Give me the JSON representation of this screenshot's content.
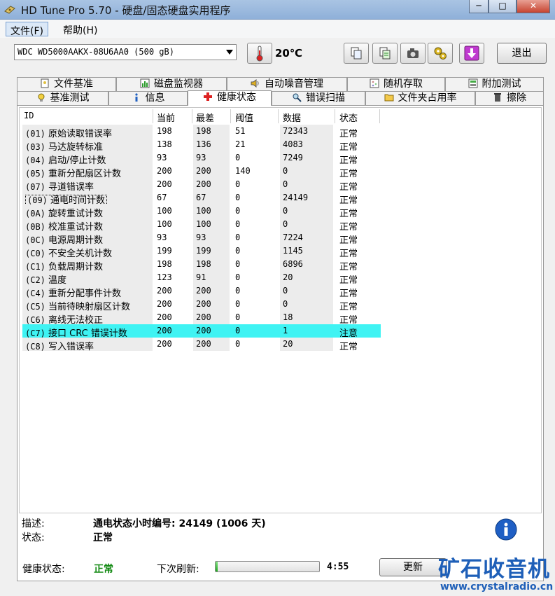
{
  "window": {
    "title": "HD Tune Pro 5.70 - 硬盘/固态硬盘实用程序",
    "minimize": "─",
    "maximize": "□",
    "close": "✕"
  },
  "menu": {
    "file": "文件(F)",
    "help": "帮助(H)"
  },
  "toolbar": {
    "drive": "WDC WD5000AAKX-08U6AA0 (500 gB)",
    "temperature": "20℃",
    "exit_label": "退出"
  },
  "tabs_row1": [
    {
      "label": "文件基准",
      "icon": "file-benchmark-icon"
    },
    {
      "label": "磁盘监视器",
      "icon": "disk-monitor-icon"
    },
    {
      "label": "自动噪音管理",
      "icon": "speaker-icon"
    },
    {
      "label": "随机存取",
      "icon": "random-access-icon"
    },
    {
      "label": "附加测试",
      "icon": "extra-tests-icon"
    }
  ],
  "tabs_row2": [
    {
      "label": "基准测试",
      "icon": "benchmark-icon"
    },
    {
      "label": "信息",
      "icon": "info-icon"
    },
    {
      "label": "健康状态",
      "icon": "health-cross-icon"
    },
    {
      "label": "错误扫描",
      "icon": "error-scan-icon"
    },
    {
      "label": "文件夹占用率",
      "icon": "folder-icon"
    },
    {
      "label": "擦除",
      "icon": "erase-icon"
    }
  ],
  "table": {
    "headers": [
      "ID",
      "当前",
      "最差",
      "阈值",
      "数据",
      "状态"
    ],
    "rows": [
      {
        "id": "(01)",
        "name": "原始读取错误率",
        "current": "198",
        "worst": "198",
        "threshold": "51",
        "data": "72343",
        "status": "正常"
      },
      {
        "id": "(03)",
        "name": "马达旋转标准",
        "current": "138",
        "worst": "136",
        "threshold": "21",
        "data": "4083",
        "status": "正常"
      },
      {
        "id": "(04)",
        "name": "启动/停止计数",
        "current": "93",
        "worst": "93",
        "threshold": "0",
        "data": "7249",
        "status": "正常"
      },
      {
        "id": "(05)",
        "name": "重新分配扇区计数",
        "current": "200",
        "worst": "200",
        "threshold": "140",
        "data": "0",
        "status": "正常"
      },
      {
        "id": "(07)",
        "name": "寻道错误率",
        "current": "200",
        "worst": "200",
        "threshold": "0",
        "data": "0",
        "status": "正常"
      },
      {
        "id": "(09)",
        "name": "通电时间计数",
        "current": "67",
        "worst": "67",
        "threshold": "0",
        "data": "24149",
        "status": "正常"
      },
      {
        "id": "(0A)",
        "name": "旋转重试计数",
        "current": "100",
        "worst": "100",
        "threshold": "0",
        "data": "0",
        "status": "正常"
      },
      {
        "id": "(0B)",
        "name": "校准重试计数",
        "current": "100",
        "worst": "100",
        "threshold": "0",
        "data": "0",
        "status": "正常"
      },
      {
        "id": "(0C)",
        "name": "电源周期计数",
        "current": "93",
        "worst": "93",
        "threshold": "0",
        "data": "7224",
        "status": "正常"
      },
      {
        "id": "(C0)",
        "name": "不安全关机计数",
        "current": "199",
        "worst": "199",
        "threshold": "0",
        "data": "1145",
        "status": "正常"
      },
      {
        "id": "(C1)",
        "name": "负载周期计数",
        "current": "198",
        "worst": "198",
        "threshold": "0",
        "data": "6896",
        "status": "正常"
      },
      {
        "id": "(C2)",
        "name": "温度",
        "current": "123",
        "worst": "91",
        "threshold": "0",
        "data": "20",
        "status": "正常"
      },
      {
        "id": "(C4)",
        "name": "重新分配事件计数",
        "current": "200",
        "worst": "200",
        "threshold": "0",
        "data": "0",
        "status": "正常"
      },
      {
        "id": "(C5)",
        "name": "当前待映射扇区计数",
        "current": "200",
        "worst": "200",
        "threshold": "0",
        "data": "0",
        "status": "正常"
      },
      {
        "id": "(C6)",
        "name": "离线无法校正",
        "current": "200",
        "worst": "200",
        "threshold": "0",
        "data": "18",
        "status": "正常"
      },
      {
        "id": "(C7)",
        "name": "接口 CRC 错误计数",
        "current": "200",
        "worst": "200",
        "threshold": "0",
        "data": "1",
        "status": "注意"
      },
      {
        "id": "(C8)",
        "name": "写入错误率",
        "current": "200",
        "worst": "200",
        "threshold": "0",
        "data": "20",
        "status": "正常"
      }
    ]
  },
  "details": {
    "description_label": "描述:",
    "description_value": "通电状态小时编号: 24149 (1006 天)",
    "status_label": "状态:",
    "status_value": "正常"
  },
  "footer": {
    "health_label": "健康状态:",
    "health_value": "正常",
    "next_refresh_label": "下次刷新:",
    "refresh_progress": 0.02,
    "countdown": "4:55",
    "refresh_button": "更新"
  },
  "watermark": {
    "brand": "矿石收音机",
    "url": "www.crystalradio.cn"
  },
  "colors": {
    "warning_row": "#3ff3f3",
    "ok_green": "#138a13"
  }
}
